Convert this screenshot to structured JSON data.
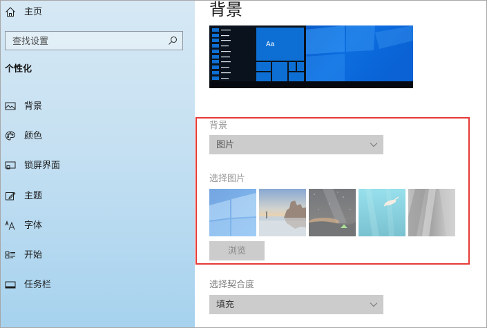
{
  "sidebar": {
    "home_label": "主页",
    "home_icon": "home-icon",
    "search": {
      "placeholder": "查找设置",
      "icon": "search-icon"
    },
    "section_title": "个性化",
    "items": [
      {
        "label": "背景",
        "icon": "picture-icon"
      },
      {
        "label": "颜色",
        "icon": "palette-icon"
      },
      {
        "label": "锁屏界面",
        "icon": "lock-screen-icon"
      },
      {
        "label": "主题",
        "icon": "theme-icon"
      },
      {
        "label": "字体",
        "icon": "font-icon"
      },
      {
        "label": "开始",
        "icon": "start-icon"
      },
      {
        "label": "任务栏",
        "icon": "taskbar-icon"
      }
    ]
  },
  "main": {
    "page_title": "背景",
    "preview": {
      "tile_text": "Aa"
    },
    "background_setting": {
      "label": "背景",
      "selected": "图片",
      "icon": "chevron-down-icon"
    },
    "choose_picture": {
      "label": "选择图片"
    },
    "browse_button": "浏览",
    "fit_setting": {
      "label": "选择契合度",
      "selected": "填充",
      "icon": "chevron-down-icon"
    }
  },
  "colors": {
    "accent": "#0d6fd3",
    "highlight_border": "#e53935",
    "control_fill": "#cccccc",
    "sidebar_top": "#d6e8f4",
    "sidebar_bottom": "#a6d2ee"
  }
}
